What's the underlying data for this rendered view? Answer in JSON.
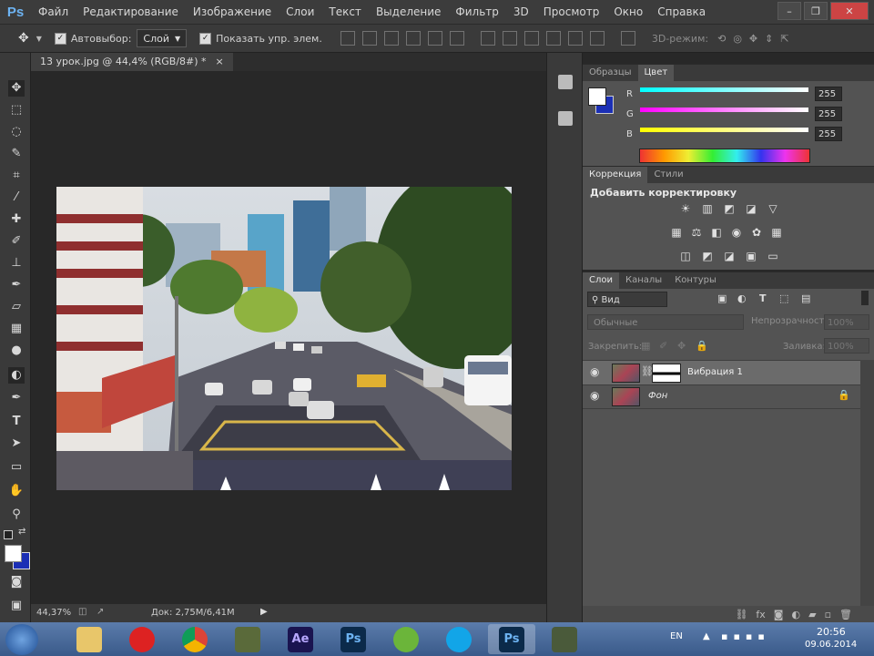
{
  "app": {
    "logo": "Ps"
  },
  "menu": [
    "Файл",
    "Редактирование",
    "Изображение",
    "Слои",
    "Текст",
    "Выделение",
    "Фильтр",
    "3D",
    "Просмотр",
    "Окно",
    "Справка"
  ],
  "window_buttons": [
    "–",
    "❐",
    "✕"
  ],
  "options": {
    "autoselect_label": "Автовыбор:",
    "autoselect_value": "Слой",
    "show_controls_label": "Показать упр. элем.",
    "mode_3d_label": "3D-режим:"
  },
  "document": {
    "tab_title": "13 урок.jpg @ 44,4% (RGB/8#) *",
    "close": "×"
  },
  "status": {
    "zoom": "44,37%",
    "doc_info": "Док: 2,75M/6,41M"
  },
  "color_panel": {
    "tabs": [
      "Образцы",
      "Цвет"
    ],
    "channels": [
      {
        "label": "R",
        "value": "255"
      },
      {
        "label": "G",
        "value": "255"
      },
      {
        "label": "B",
        "value": "255"
      }
    ]
  },
  "correction_panel": {
    "tabs": [
      "Коррекция",
      "Стили"
    ],
    "title": "Добавить корректировку"
  },
  "layers_panel": {
    "tabs": [
      "Слои",
      "Каналы",
      "Контуры"
    ],
    "filter_value": "Вид",
    "blend_mode": "Обычные",
    "opacity_label": "Непрозрачность:",
    "opacity_value": "100%",
    "lock_label": "Закрепить:",
    "fill_label": "Заливка:",
    "fill_value": "100%",
    "layers": [
      {
        "name": "Вибрация 1"
      },
      {
        "name": "Фон"
      }
    ]
  },
  "taskbar": {
    "apps": [
      "Ae",
      "Ps",
      "Ps"
    ],
    "lang": "EN",
    "time": "20:56",
    "date": "09.06.2014"
  }
}
